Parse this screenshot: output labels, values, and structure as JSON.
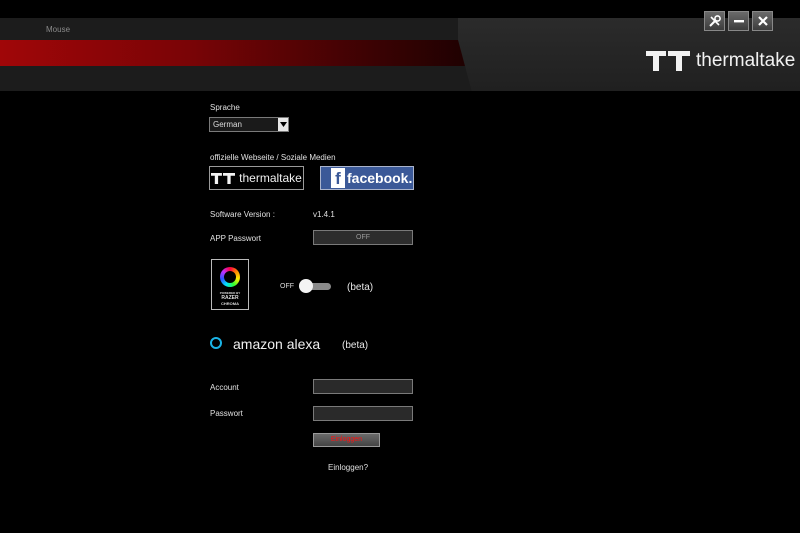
{
  "nav": {
    "mouse_tab": "Mouse"
  },
  "brand": {
    "name": "thermaltake"
  },
  "window_controls": {
    "settings_icon": "wrench-icon",
    "minimize_icon": "minimize-icon",
    "close_icon": "close-icon"
  },
  "language": {
    "label": "Sprache",
    "selected": "German"
  },
  "social": {
    "label": "offizielle Webseite / Soziale Medien",
    "thermaltake_label": "thermaltake",
    "facebook_label": "facebook."
  },
  "software_version": {
    "label": "Software Version :",
    "value": "v1.4.1"
  },
  "app_password": {
    "label": "APP Passwort",
    "button": "OFF"
  },
  "chroma": {
    "line1": "POWERED BY",
    "line2": "RAZER",
    "line3": "CHROMA",
    "toggle_label": "OFF",
    "beta": "(beta)",
    "enabled": false
  },
  "alexa": {
    "name": "amazon alexa",
    "beta": "(beta)"
  },
  "login": {
    "account_label": "Account",
    "account_value": "",
    "password_label": "Passwort",
    "password_value": "",
    "button": "Einloggen",
    "link": "Einloggen?"
  },
  "colors": {
    "accent_red": "#a00608",
    "facebook_blue": "#3b5998",
    "alexa_blue": "#1ab3e6"
  }
}
